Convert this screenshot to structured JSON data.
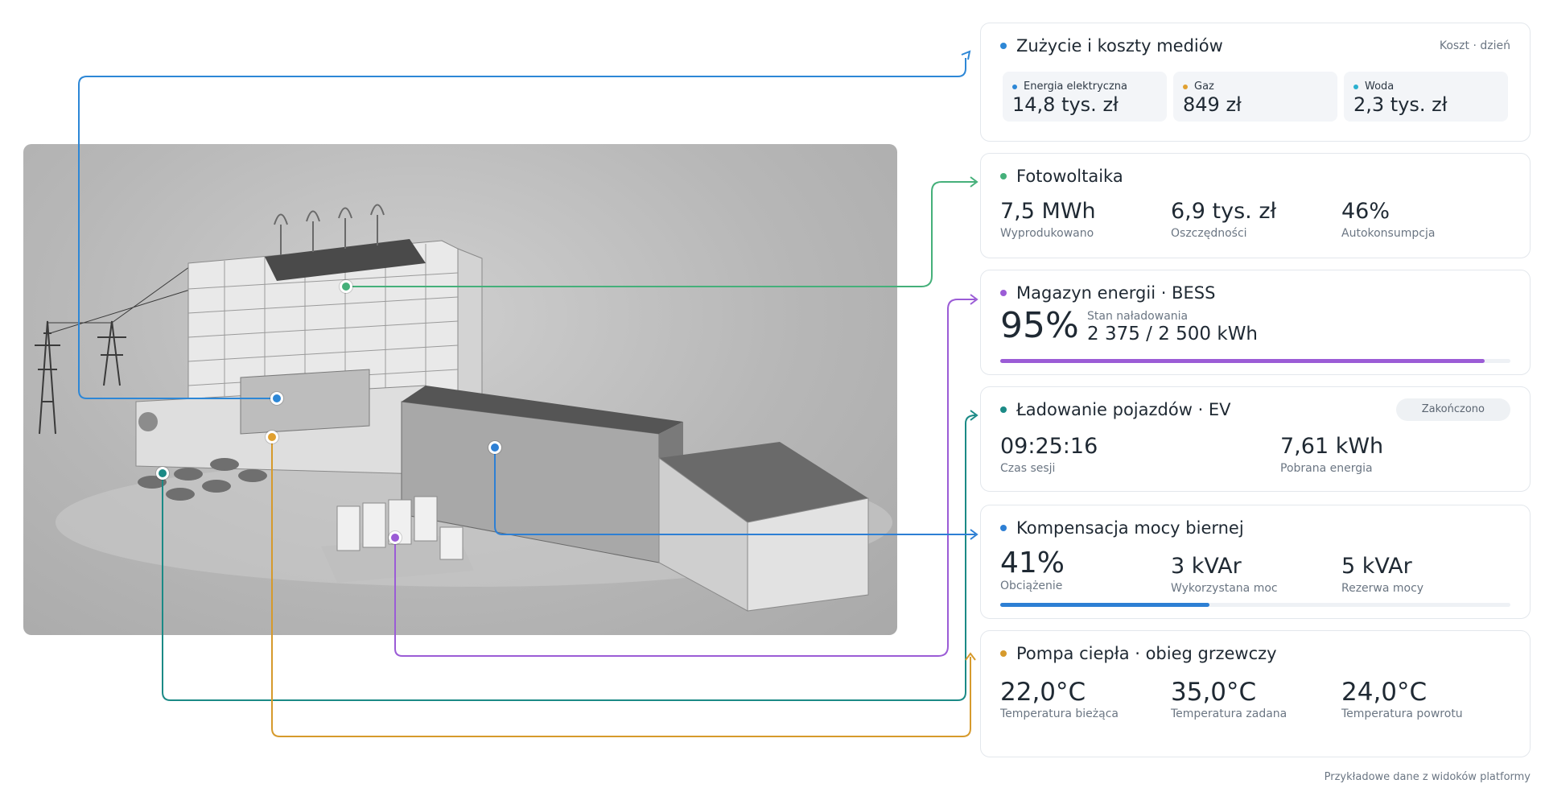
{
  "colors": {
    "electric": "#2d87d6",
    "gas": "#e0a030",
    "water": "#2bb0cf",
    "pv": "#45b07a",
    "bess": "#9b5cd6",
    "ev": "#1b8a86",
    "compensation": "#2d7fd4",
    "heatpump": "#d69a2c"
  },
  "media": {
    "title": "Zużycie i koszty mediów",
    "subtitle": "Koszt · dzień",
    "items": [
      {
        "label": "Energia elektryczna",
        "value": "14,8 tys. zł"
      },
      {
        "label": "Gaz",
        "value": "849 zł"
      },
      {
        "label": "Woda",
        "value": "2,3 tys. zł"
      }
    ]
  },
  "pv": {
    "title": "Fotowoltaika",
    "metrics": [
      {
        "value": "7,5 MWh",
        "label": "Wyprodukowano"
      },
      {
        "value": "6,9 tys. zł",
        "label": "Oszczędności"
      },
      {
        "value": "46%",
        "label": "Autokonsumpcja"
      }
    ]
  },
  "bess": {
    "title": "Magazyn energii · BESS",
    "percent": "95%",
    "label": "Stan naładowania",
    "value": "2 375 / 2 500 kWh",
    "level": 0.95
  },
  "ev": {
    "title": "Ładowanie pojazdów · EV",
    "status": "Zakończono",
    "metrics": [
      {
        "value": "09:25:16",
        "label": "Czas sesji"
      },
      {
        "value": "7,61 kWh",
        "label": "Pobrana energia"
      }
    ]
  },
  "compensation": {
    "title": "Kompensacja mocy biernej",
    "metrics": [
      {
        "value": "41%",
        "label": "Obciążenie"
      },
      {
        "value": "3 kVAr",
        "label": "Wykorzystana moc"
      },
      {
        "value": "5 kVAr",
        "label": "Rezerwa mocy"
      }
    ],
    "level": 0.41
  },
  "heatpump": {
    "title": "Pompa ciepła · obieg grzewczy",
    "metrics": [
      {
        "value": "22,0°C",
        "label": "Temperatura bieżąca"
      },
      {
        "value": "35,0°C",
        "label": "Temperatura zadana"
      },
      {
        "value": "24,0°C",
        "label": "Temperatura powrotu"
      }
    ]
  },
  "footer": "Przykładowe dane z widoków platformy"
}
